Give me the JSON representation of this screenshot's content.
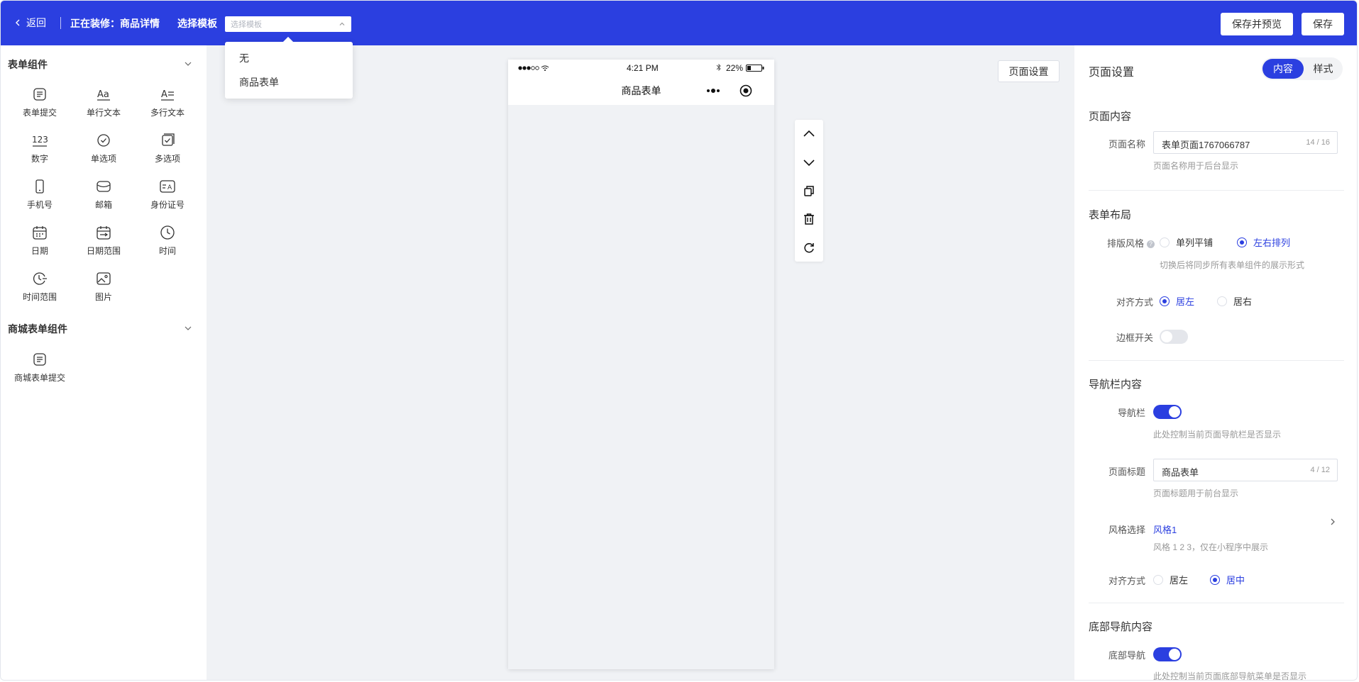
{
  "header": {
    "back_label": "返回",
    "editing_label": "正在装修：商品详情",
    "template_label": "选择模板",
    "template_placeholder": "选择模板",
    "save_preview_label": "保存并预览",
    "save_label": "保存"
  },
  "template_dropdown": {
    "options": [
      "无",
      "商品表单"
    ]
  },
  "left_panel": {
    "sections": [
      {
        "title": "表单组件",
        "items": [
          {
            "label": "表单提交",
            "icon": "form-submit-icon"
          },
          {
            "label": "单行文本",
            "icon": "single-line-text-icon"
          },
          {
            "label": "多行文本",
            "icon": "multi-line-text-icon"
          },
          {
            "label": "数字",
            "icon": "number-icon"
          },
          {
            "label": "单选项",
            "icon": "radio-icon"
          },
          {
            "label": "多选项",
            "icon": "checkbox-icon"
          },
          {
            "label": "手机号",
            "icon": "mobile-phone-icon"
          },
          {
            "label": "邮箱",
            "icon": "email-icon"
          },
          {
            "label": "身份证号",
            "icon": "id-card-icon"
          },
          {
            "label": "日期",
            "icon": "calendar-icon"
          },
          {
            "label": "日期范围",
            "icon": "date-range-icon"
          },
          {
            "label": "时间",
            "icon": "clock-icon"
          },
          {
            "label": "时间范围",
            "icon": "time-range-icon"
          },
          {
            "label": "图片",
            "icon": "image-icon"
          }
        ]
      },
      {
        "title": "商城表单组件",
        "items": [
          {
            "label": "商城表单提交",
            "icon": "mall-form-submit-icon"
          }
        ]
      }
    ]
  },
  "phone": {
    "status_time": "4:21 PM",
    "battery": "22%",
    "title": "商品表单"
  },
  "canvas": {
    "page_settings_button": "页面设置"
  },
  "right_panel": {
    "title": "页面设置",
    "tabs": [
      "内容",
      "样式"
    ],
    "active_tab": "内容",
    "page_content": {
      "section": "页面内容",
      "name_label": "页面名称",
      "name_value": "表单页面1767066787",
      "name_count": "14 / 16",
      "name_help": "页面名称用于后台显示"
    },
    "form_layout": {
      "section": "表单布局",
      "style_label": "排版风格",
      "style_options": [
        "单列平铺",
        "左右排列"
      ],
      "style_selected": "左右排列",
      "style_help": "切换后将同步所有表单组件的展示形式",
      "align_label": "对齐方式",
      "align_options": [
        "居左",
        "居右"
      ],
      "align_selected": "居左",
      "border_label": "边框开关",
      "border_on": false
    },
    "navbar": {
      "section": "导航栏内容",
      "navbar_label": "导航栏",
      "navbar_on": true,
      "navbar_help": "此处控制当前页面导航栏是否显示",
      "title_label": "页面标题",
      "title_value": "商品表单",
      "title_count": "4 / 12",
      "title_help": "页面标题用于前台显示",
      "style_label": "风格选择",
      "style_value": "风格1",
      "style_help": "风格 1 2 3，仅在小程序中展示",
      "align_label": "对齐方式",
      "align_options": [
        "居左",
        "居中"
      ],
      "align_selected": "居中"
    },
    "bottom_nav": {
      "section": "底部导航内容",
      "label": "底部导航",
      "on": true,
      "help": "此处控制当前页面底部导航菜单是否显示"
    }
  },
  "colors": {
    "primary": "#2b3fe0",
    "canvas_bg": "#f0f2f5"
  }
}
